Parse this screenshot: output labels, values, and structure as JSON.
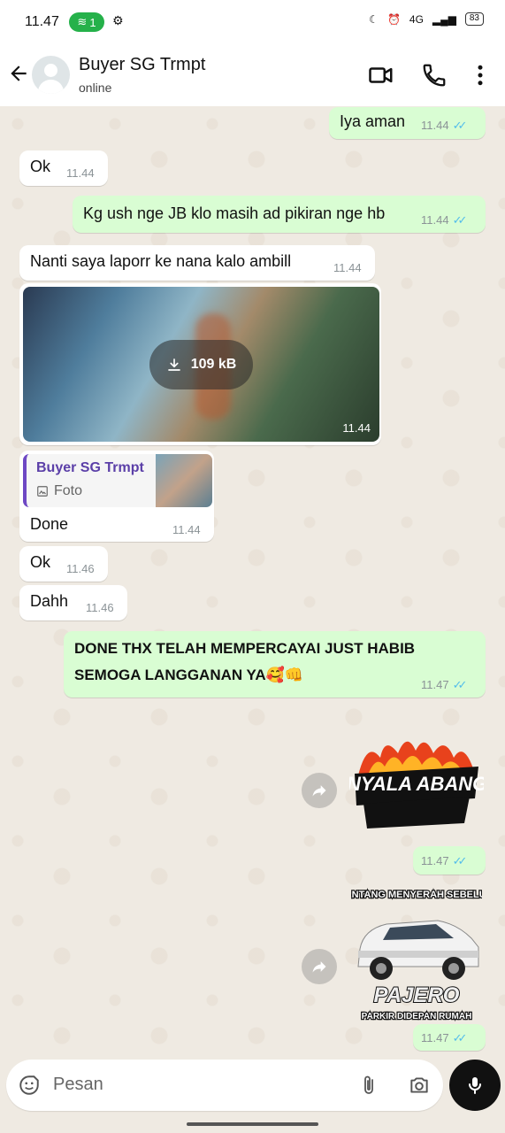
{
  "status_bar": {
    "time": "11.47",
    "hotspot_count": "1",
    "battery": "83",
    "network": "4G"
  },
  "header": {
    "contact_name": "Buyer SG Trmpt",
    "contact_status": "online"
  },
  "messages": [
    {
      "dir": "out",
      "text": "Iya aman",
      "time": "11.44",
      "read": true
    },
    {
      "dir": "in",
      "text": "Ok",
      "time": "11.44"
    },
    {
      "dir": "out",
      "text": "Kg ush nge JB klo masih ad pikiran nge hb",
      "time": "11.44",
      "read": true
    },
    {
      "dir": "in",
      "text": "Nanti saya laporr ke nana kalo ambill",
      "time": "11.44"
    },
    {
      "dir": "in",
      "type": "image",
      "download_size": "109 kB",
      "time": "11.44"
    },
    {
      "dir": "in",
      "type": "reply",
      "quote_name": "Buyer SG Trmpt",
      "quote_sub": "Foto",
      "text": "Done",
      "time": "11.44"
    },
    {
      "dir": "in",
      "text": "Ok",
      "time": "11.46"
    },
    {
      "dir": "in",
      "text": "Dahh",
      "time": "11.46"
    },
    {
      "dir": "out",
      "text_line1": "DONE THX TELAH MEMPERCAYAI JUST HABIB",
      "text_line2": "SEMOGA LANGGANAN YA🥰👊",
      "time": "11.47",
      "read": true
    },
    {
      "dir": "out",
      "type": "sticker",
      "sticker_text": "MENYALA ABANGKU",
      "time": "11.47",
      "read": true
    },
    {
      "dir": "out",
      "type": "sticker",
      "sticker_top": "PANTANG MENYERAH SEBELUM",
      "sticker_brand": "PAJERO",
      "sticker_bottom": "PARKIR DIDEPAN RUMAH",
      "time": "11.47",
      "read": true
    }
  ],
  "input": {
    "placeholder": "Pesan"
  },
  "colors": {
    "incoming": "#ffffff",
    "outgoing": "#d9fdd3",
    "read_ticks": "#53bdeb",
    "background": "#efeae2"
  }
}
